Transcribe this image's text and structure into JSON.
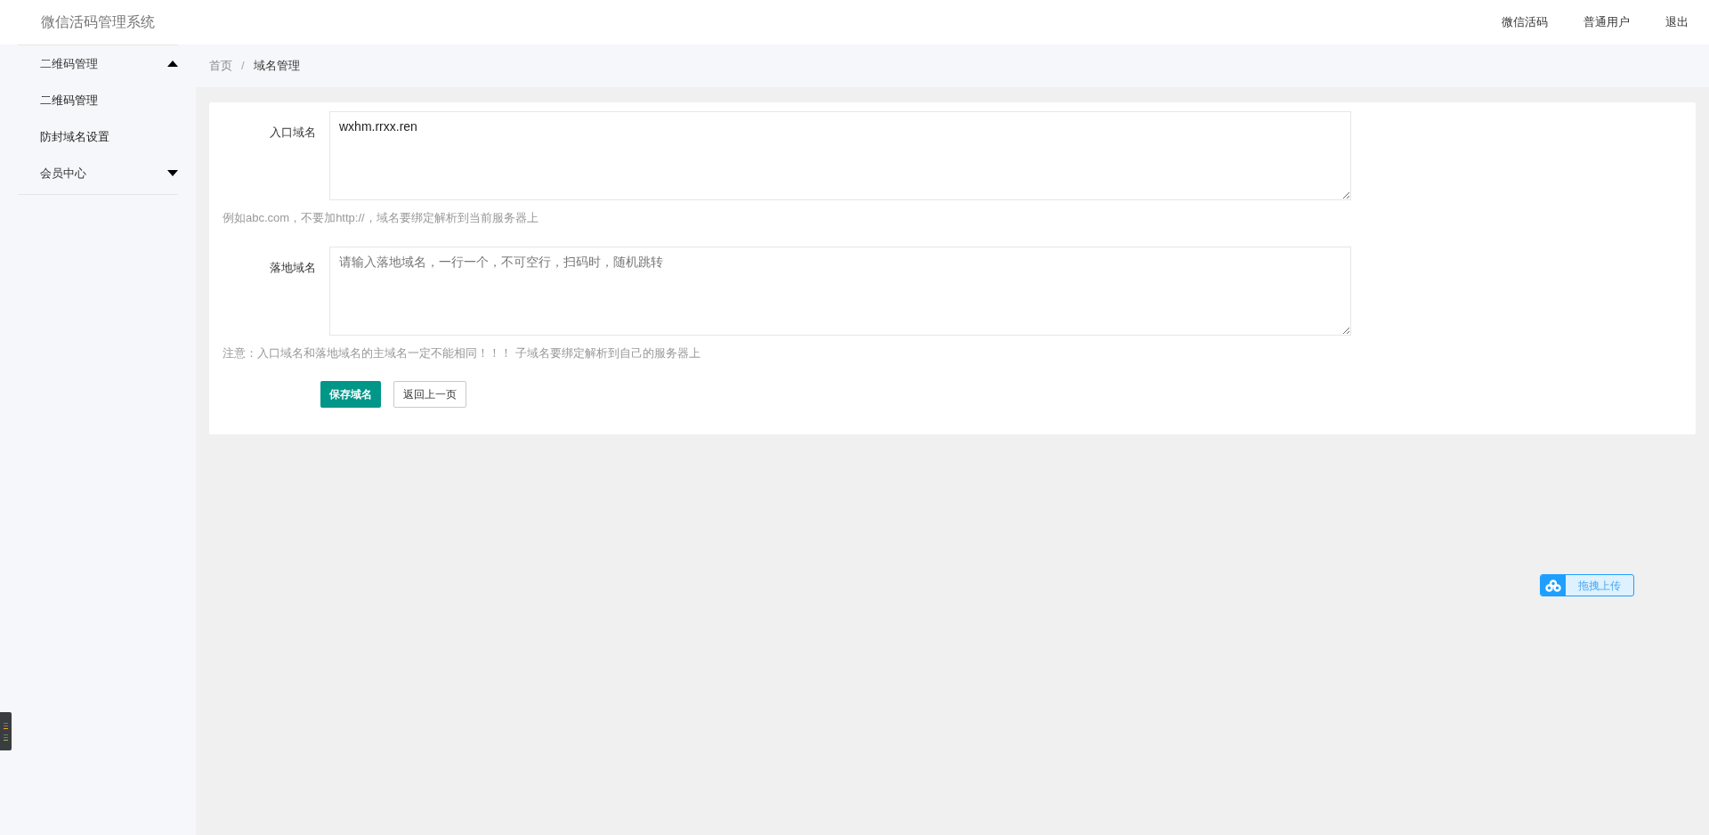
{
  "header": {
    "title": "微信活码管理系统",
    "nav": [
      "微信活码",
      "普通用户",
      "退出"
    ]
  },
  "sidebar": {
    "items": [
      {
        "label": "二维码管理",
        "expanded": true,
        "children": [
          {
            "label": "二维码管理"
          },
          {
            "label": "防封域名设置"
          }
        ]
      },
      {
        "label": "会员中心",
        "expanded": false
      }
    ]
  },
  "breadcrumb": {
    "separator": "/",
    "items": [
      "首页",
      "域名管理"
    ]
  },
  "form": {
    "fields": [
      {
        "label": "入口域名",
        "value": "wxhm.rrxx.ren",
        "hint": "例如abc.com，不要加http://，域名要绑定解析到当前服务器上"
      },
      {
        "label": "落地域名",
        "placeholder": "请输入落地域名，一行一个，不可空行，扫码时，随机跳转",
        "hint": "注意：入口域名和落地域名的主域名一定不能相同！！！ 子域名要绑定解析到自己的服务器上"
      }
    ],
    "buttons": [
      {
        "label": "保存域名",
        "kind": "primary"
      },
      {
        "label": "返回上一页",
        "kind": "secondary"
      }
    ]
  },
  "upload_widget": {
    "label": "拖拽上传"
  }
}
